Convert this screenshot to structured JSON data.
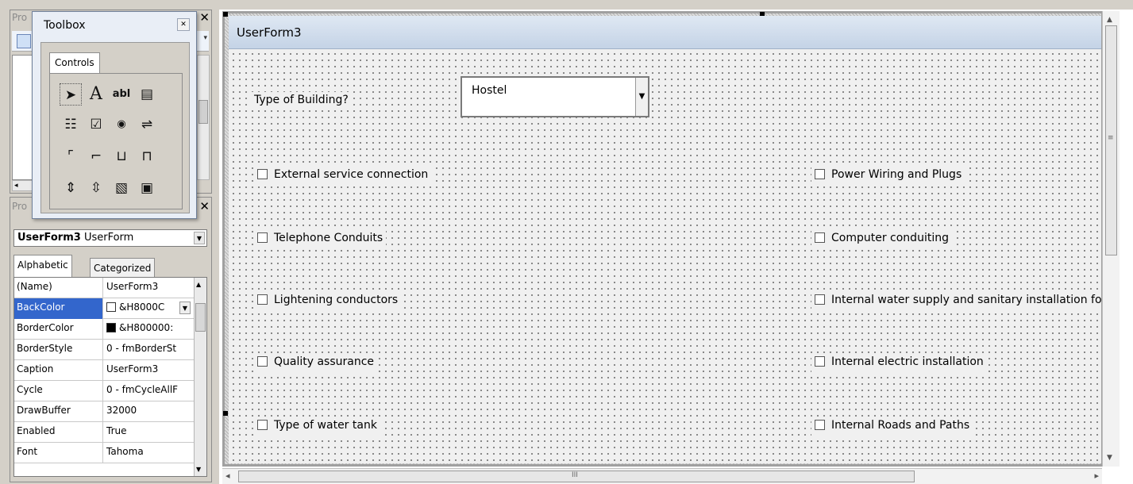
{
  "project_pane": {
    "title": "Pro",
    "close_glyph": "✕"
  },
  "toolbox": {
    "title": "Toolbox",
    "close_glyph": "✕",
    "tab": "Controls",
    "tools": [
      {
        "name": "select-objects-icon",
        "glyph": "➤"
      },
      {
        "name": "label-icon",
        "glyph": "A"
      },
      {
        "name": "textbox-icon",
        "glyph": "abl"
      },
      {
        "name": "combobox-icon",
        "glyph": "▤"
      },
      {
        "name": "listbox-icon",
        "glyph": "☷"
      },
      {
        "name": "checkbox-icon",
        "glyph": "☑"
      },
      {
        "name": "optionbutton-icon",
        "glyph": "◉"
      },
      {
        "name": "togglebutton-icon",
        "glyph": "⇌"
      },
      {
        "name": "frame-icon",
        "glyph": "⌜"
      },
      {
        "name": "commandbutton-icon",
        "glyph": "⌐"
      },
      {
        "name": "tabstrip-icon",
        "glyph": "⊔"
      },
      {
        "name": "multipage-icon",
        "glyph": "⊓"
      },
      {
        "name": "scrollbar-icon",
        "glyph": "⇕"
      },
      {
        "name": "spinbutton-icon",
        "glyph": "⇳"
      },
      {
        "name": "image-icon",
        "glyph": "▧"
      },
      {
        "name": "refedit-icon",
        "glyph": "▣"
      }
    ]
  },
  "properties": {
    "title": "Pro",
    "close_glyph": "✕",
    "object_name": "UserForm3",
    "object_type": "UserForm",
    "tabs": [
      "Alphabetic",
      "Categorized"
    ],
    "rows": [
      {
        "name": "(Name)",
        "value": "UserForm3"
      },
      {
        "name": "BackColor",
        "value": "&H8000C"
      },
      {
        "name": "BorderColor",
        "value": "&H800000:"
      },
      {
        "name": "BorderStyle",
        "value": "0 - fmBorderSt"
      },
      {
        "name": "Caption",
        "value": "UserForm3"
      },
      {
        "name": "Cycle",
        "value": "0 - fmCycleAllF"
      },
      {
        "name": "DrawBuffer",
        "value": "32000"
      },
      {
        "name": "Enabled",
        "value": "True"
      },
      {
        "name": "Font",
        "value": "Tahoma"
      }
    ],
    "selected_row": "BackColor"
  },
  "form": {
    "title": "UserForm3",
    "building_label": "Type of Building?",
    "building_value": "Hostel",
    "checkboxes_left": [
      "External service connection",
      "Telephone Conduits",
      "Lightening conductors",
      "Quality assurance",
      "Type of water tank"
    ],
    "checkboxes_right": [
      "Power Wiring and Plugs",
      "Computer conduiting",
      "Internal water supply and sanitary installation for",
      "Internal electric installation",
      "Internal Roads and Paths"
    ]
  },
  "scroll": {
    "grip_glyph": "III"
  },
  "colors": {
    "selected_row": "#3366cc",
    "form_title_bar": "#c4d3e6"
  }
}
